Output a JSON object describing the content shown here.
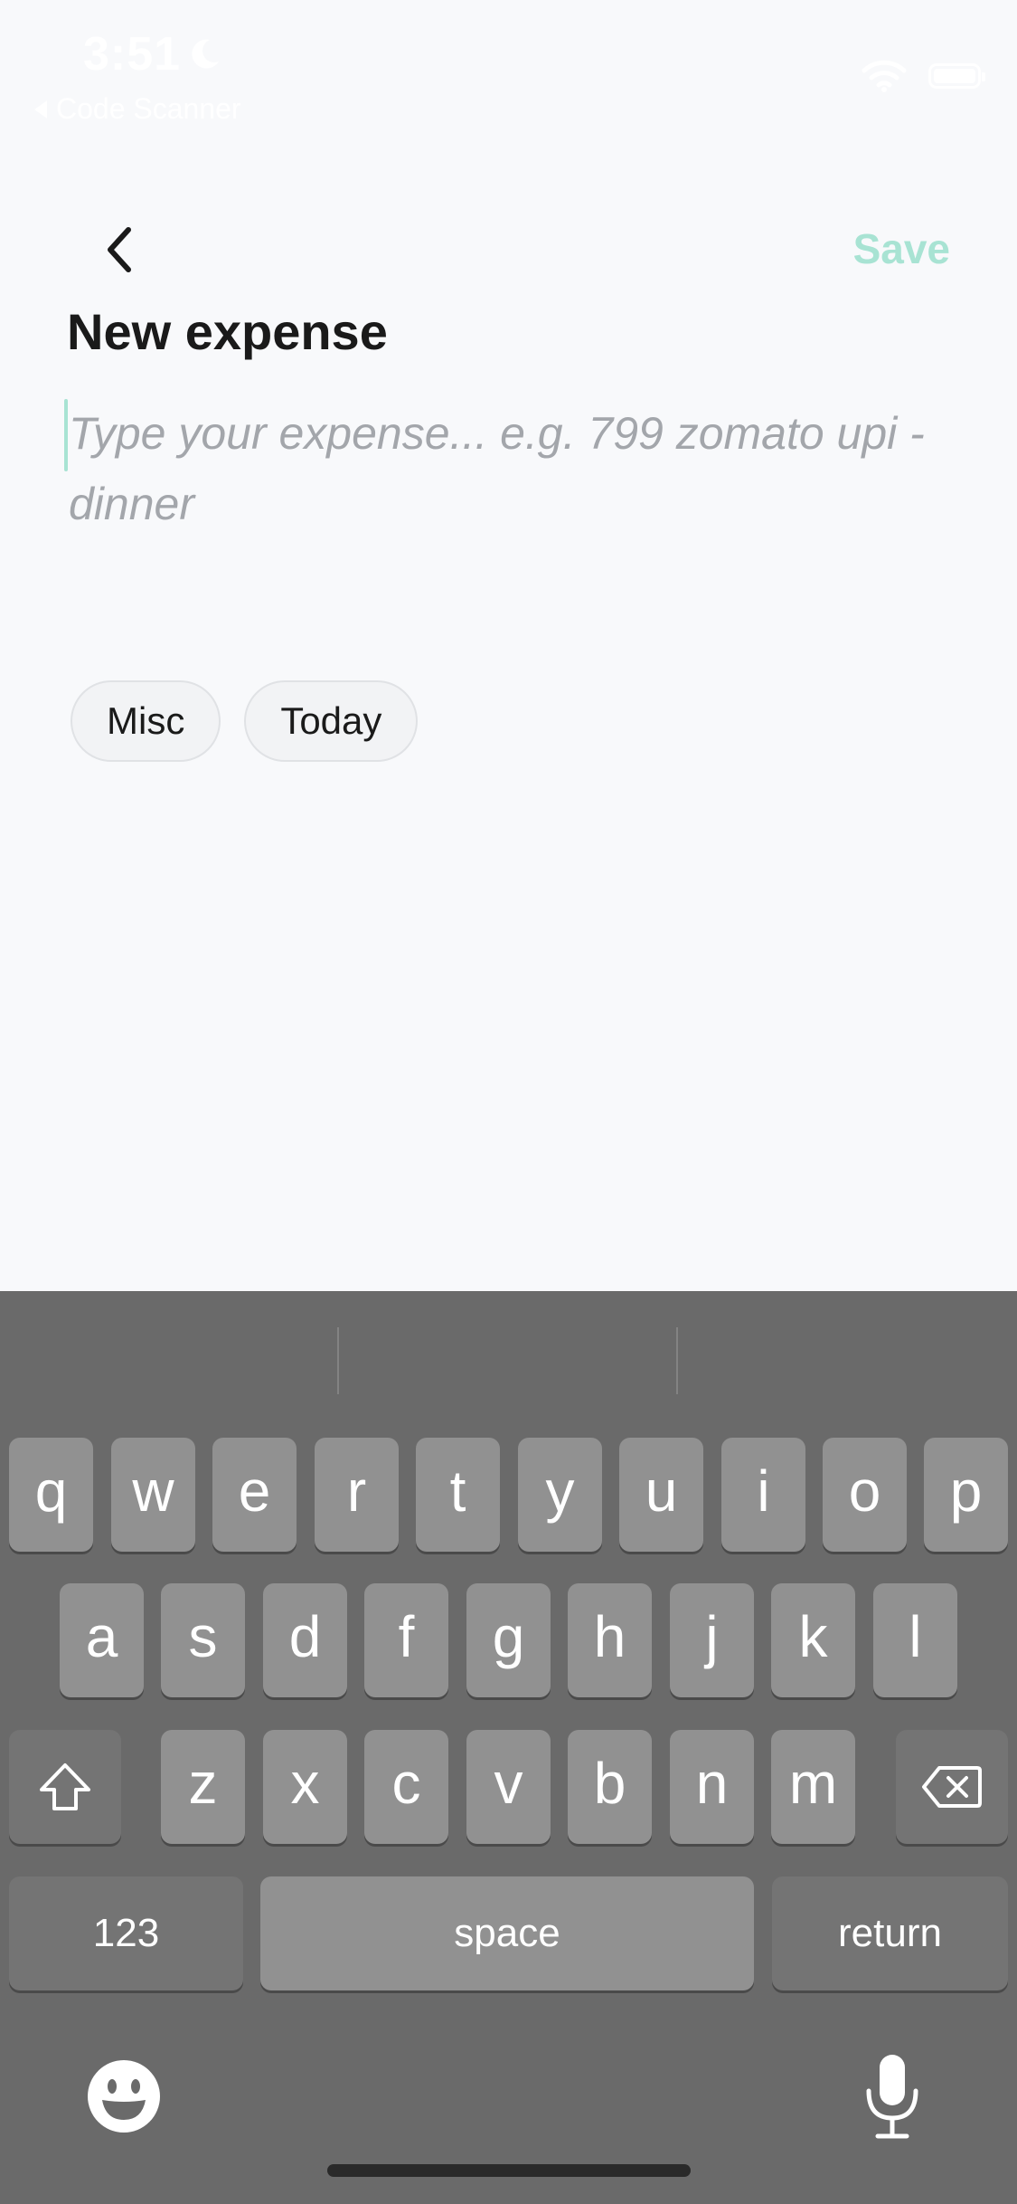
{
  "status_bar": {
    "time": "3:51",
    "back_app": "Code Scanner"
  },
  "nav": {
    "save_label": "Save"
  },
  "page": {
    "title": "New expense"
  },
  "expense_input": {
    "value": "",
    "placeholder": "Type your expense... e.g. 799 zomato upi - dinner"
  },
  "chips": {
    "category": "Misc",
    "date": "Today"
  },
  "keyboard": {
    "row1": [
      "q",
      "w",
      "e",
      "r",
      "t",
      "y",
      "u",
      "i",
      "o",
      "p"
    ],
    "row2": [
      "a",
      "s",
      "d",
      "f",
      "g",
      "h",
      "j",
      "k",
      "l"
    ],
    "row3": [
      "z",
      "x",
      "c",
      "v",
      "b",
      "n",
      "m"
    ],
    "numbers_label": "123",
    "space_label": "space",
    "return_label": "return"
  },
  "colors": {
    "accent": "#a8e3d3",
    "background": "#f8f9fb",
    "keyboard_bg": "#6a6a6a",
    "key_bg": "#919191"
  },
  "icons": {
    "moon": "moon-icon",
    "wifi": "wifi-icon",
    "battery": "battery-icon",
    "back": "chevron-left-icon",
    "shift": "shift-icon",
    "delete": "delete-icon",
    "emoji": "emoji-icon",
    "mic": "microphone-icon"
  }
}
